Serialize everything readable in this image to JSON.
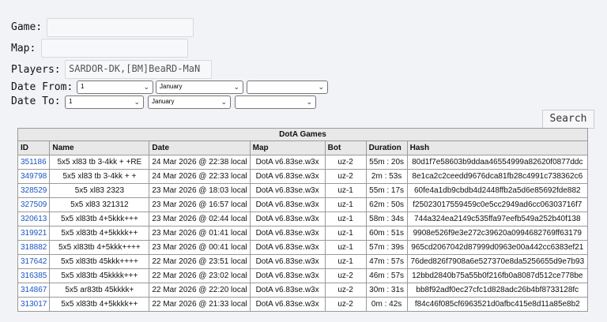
{
  "form": {
    "game_label": "Game:",
    "game_value": "",
    "map_label": "Map:",
    "map_value": "",
    "players_label": "Players:",
    "players_value": "SARDOR-DK,[BM]BeaRD-MaN",
    "date_from_label": "Date From:",
    "date_from": {
      "day": "1",
      "month": "January",
      "year": ""
    },
    "date_to_label": "Date To:",
    "date_to": {
      "day": "1",
      "month": "January",
      "year": ""
    },
    "search_label": "Search"
  },
  "table": {
    "caption": "DotA Games",
    "headers": [
      "ID",
      "Name",
      "Date",
      "Map",
      "Bot",
      "Duration",
      "Hash"
    ],
    "rows": [
      {
        "id": "351186",
        "name": "5x5 xl83 tb 3-4kk + +RE",
        "date": "24 Mar 2026 @ 22:38 local",
        "map": "DotA v6.83se.w3x",
        "bot": "uz-2",
        "duration": "55m : 20s",
        "hash": "80d1f7e58603b9ddaa46554999a82620f0877ddc"
      },
      {
        "id": "349798",
        "name": "5x5 xl83 tb 3-4kk + +",
        "date": "24 Mar 2026 @ 22:33 local",
        "map": "DotA v6.83se.w3x",
        "bot": "uz-2",
        "duration": "2m : 53s",
        "hash": "8e1ca2c2ceedd9676dca81fb28c4991c738362c6"
      },
      {
        "id": "328529",
        "name": "5x5 xl83 2323",
        "date": "23 Mar 2026 @ 18:03 local",
        "map": "DotA v6.83se.w3x",
        "bot": "uz-1",
        "duration": "55m : 17s",
        "hash": "60fe4a1db9cbdb4d2448ffb2a5d6e85692fde882"
      },
      {
        "id": "327509",
        "name": "5x5 xl83 321312",
        "date": "23 Mar 2026 @ 16:57 local",
        "map": "DotA v6.83se.w3x",
        "bot": "uz-1",
        "duration": "62m : 50s",
        "hash": "f25023017559459c0e5cc2949ad6cc06303716f7"
      },
      {
        "id": "320613",
        "name": "5x5 xl83tb 4+5kkk+++",
        "date": "23 Mar 2026 @ 02:44 local",
        "map": "DotA v6.83se.w3x",
        "bot": "uz-1",
        "duration": "58m : 34s",
        "hash": "744a324ea2149c535ffa97eefb549a252b40f138"
      },
      {
        "id": "319921",
        "name": "5x5 xl83tb 4+5kkkk++",
        "date": "23 Mar 2026 @ 01:41 local",
        "map": "DotA v6.83se.w3x",
        "bot": "uz-1",
        "duration": "60m : 51s",
        "hash": "9908e526f9e3e272c39620a0994682769ff63179"
      },
      {
        "id": "318882",
        "name": "5x5 xl83tb 4+5kkk++++",
        "date": "23 Mar 2026 @ 00:41 local",
        "map": "DotA v6.83se.w3x",
        "bot": "uz-1",
        "duration": "57m : 39s",
        "hash": "965cd2067042d87999d0963e00a442cc6383ef21"
      },
      {
        "id": "317642",
        "name": "5x5 xl83tb 45kkk++++",
        "date": "22 Mar 2026 @ 23:51 local",
        "map": "DotA v6.83se.w3x",
        "bot": "uz-1",
        "duration": "47m : 57s",
        "hash": "76ded826f7908a6e527370e8da5256655d9e7b93"
      },
      {
        "id": "316385",
        "name": "5x5 xl83tb 45kkkk+++",
        "date": "22 Mar 2026 @ 23:02 local",
        "map": "DotA v6.83se.w3x",
        "bot": "uz-2",
        "duration": "46m : 57s",
        "hash": "12bbd2840b75a55b0f216fb0a8087d512ce778be"
      },
      {
        "id": "314867",
        "name": "5x5 ar83tb 45kkkk+",
        "date": "22 Mar 2026 @ 22:20 local",
        "map": "DotA v6.83se.w3x",
        "bot": "uz-2",
        "duration": "30m : 31s",
        "hash": "bb8f92adf0ec27cfc1d828adc26b4bf8733128fc"
      },
      {
        "id": "313017",
        "name": "5x5 xl83tb 4+5kkkk++",
        "date": "22 Mar 2026 @ 21:33 local",
        "map": "DotA v6.83se.w3x",
        "bot": "uz-2",
        "duration": "0m : 42s",
        "hash": "f84c46f085cf6963521d0afbc415e8d11a85e8b2"
      }
    ]
  },
  "colors": {
    "link": "#1a56c4",
    "header_bg": "#e8e8e8",
    "page_bg": "#f1f3f6"
  }
}
